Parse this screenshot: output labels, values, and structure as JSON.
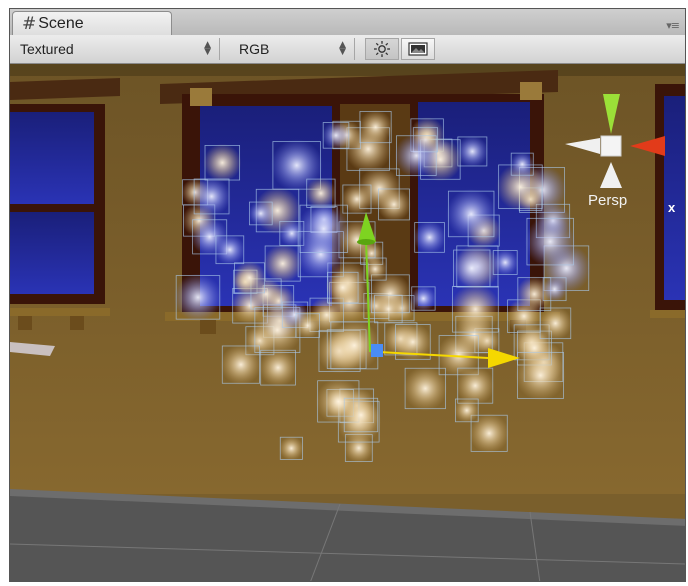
{
  "tab": {
    "icon": "hash-grid-icon",
    "title": "Scene"
  },
  "toolbar": {
    "draw_mode": "Textured",
    "render_mode": "RGB",
    "lighting_toggle_icon": "sun-icon",
    "image_toggle_icon": "image-icon",
    "pane_menu_icon": "pane-menu-icon"
  },
  "gizmo": {
    "projection_label": "Persp",
    "x_axis_label": "x"
  },
  "colors": {
    "wall": "#7a5f2c",
    "window_glass": "#1a2090",
    "window_frame": "#3a1408",
    "floor": "#595959",
    "move_y": "#7ed321",
    "move_x": "#f5d800",
    "gizmo_x": "#e23b1a"
  }
}
